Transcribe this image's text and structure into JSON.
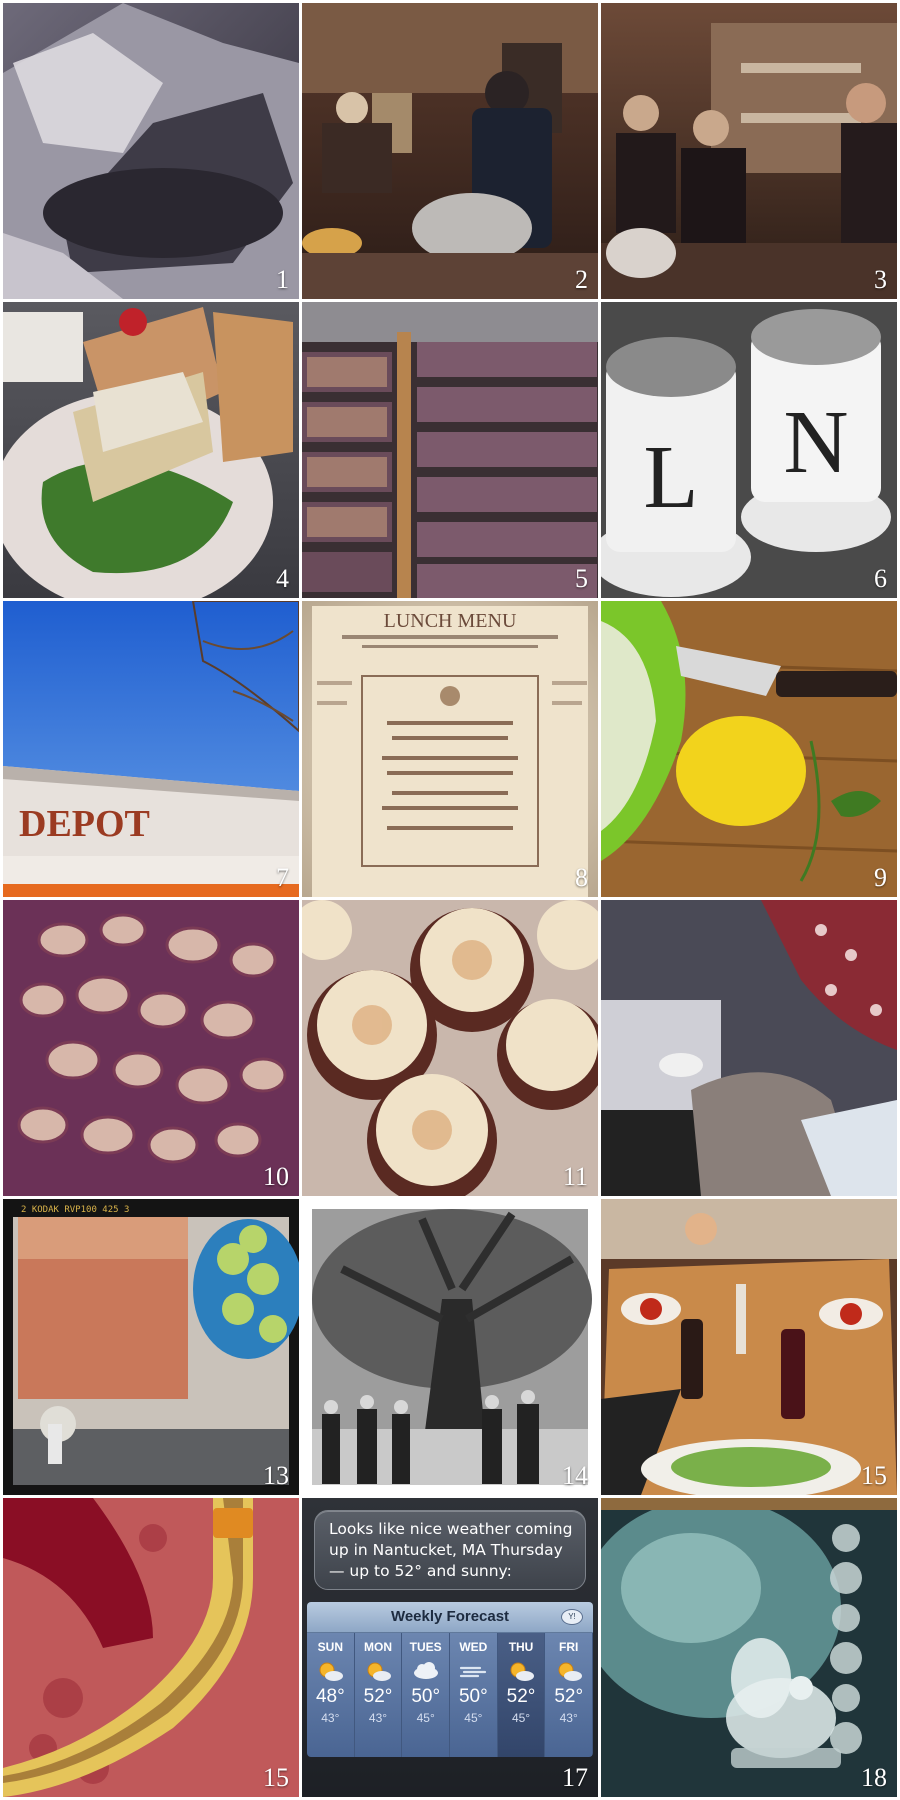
{
  "tiles": [
    {
      "number": "1"
    },
    {
      "number": "2"
    },
    {
      "number": "3"
    },
    {
      "number": "4"
    },
    {
      "number": "5"
    },
    {
      "number": "6"
    },
    {
      "number": "7",
      "sign": "DEPOT"
    },
    {
      "number": "8",
      "menu_title": "LUNCH MENU"
    },
    {
      "number": "9"
    },
    {
      "number": "10"
    },
    {
      "number": "11"
    },
    {
      "number": "",
      "note": ""
    },
    {
      "number": "13",
      "film_edge": "2  KODAK  RVP100   425   3"
    },
    {
      "number": "14"
    },
    {
      "number": "15"
    },
    {
      "number": "15"
    },
    {
      "number": "17"
    },
    {
      "number": "18"
    }
  ],
  "weather": {
    "siri_text": "Looks like nice weather coming up in Nantucket, MA Thursday — up to 52° and sunny:",
    "title": "Weekly Forecast",
    "logo": "Y!",
    "days": [
      {
        "name": "SUN",
        "hi": "48°",
        "lo": "43°",
        "icon": "sun-cloud-icon"
      },
      {
        "name": "MON",
        "hi": "52°",
        "lo": "43°",
        "icon": "sun-cloud-icon"
      },
      {
        "name": "TUES",
        "hi": "50°",
        "lo": "45°",
        "icon": "cloud-icon"
      },
      {
        "name": "WED",
        "hi": "50°",
        "lo": "45°",
        "icon": "wind-icon"
      },
      {
        "name": "THU",
        "hi": "52°",
        "lo": "45°",
        "icon": "sun-cloud-icon"
      },
      {
        "name": "FRI",
        "hi": "52°",
        "lo": "43°",
        "icon": "sun-cloud-icon"
      }
    ]
  }
}
